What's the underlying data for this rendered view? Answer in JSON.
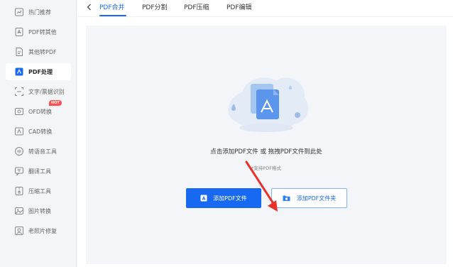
{
  "sidebar": {
    "items": [
      {
        "label": "热门推荐",
        "icon": "hot-recommend-icon"
      },
      {
        "label": "PDF转其他",
        "icon": "pdf-convert-icon"
      },
      {
        "label": "其他转PDF",
        "icon": "to-pdf-icon"
      },
      {
        "label": "PDF处理",
        "icon": "pdf-process-icon",
        "active": true
      },
      {
        "label": "文字/票据识别",
        "icon": "ocr-icon"
      },
      {
        "label": "OFD转换",
        "icon": "ofd-icon",
        "badge": "HOT"
      },
      {
        "label": "CAD转换",
        "icon": "cad-icon"
      },
      {
        "label": "转语音工具",
        "icon": "voice-icon"
      },
      {
        "label": "翻译工具",
        "icon": "translate-icon"
      },
      {
        "label": "压缩工具",
        "icon": "compress-icon"
      },
      {
        "label": "图片转换",
        "icon": "image-convert-icon"
      },
      {
        "label": "老照片修复",
        "icon": "photo-repair-icon"
      }
    ]
  },
  "tabs": [
    {
      "label": "PDF合并",
      "active": true
    },
    {
      "label": "PDF分割"
    },
    {
      "label": "PDF压缩"
    },
    {
      "label": "PDF编辑"
    }
  ],
  "main": {
    "drop_text": "点击添加PDF文件 或 拖拽PDF文件到此处",
    "support_text": "*支持PDF格式",
    "add_file_label": "添加PDF文件",
    "add_folder_label": "添加PDF文件夹"
  },
  "colors": {
    "accent": "#1769f1",
    "arrow": "#e8312a"
  }
}
